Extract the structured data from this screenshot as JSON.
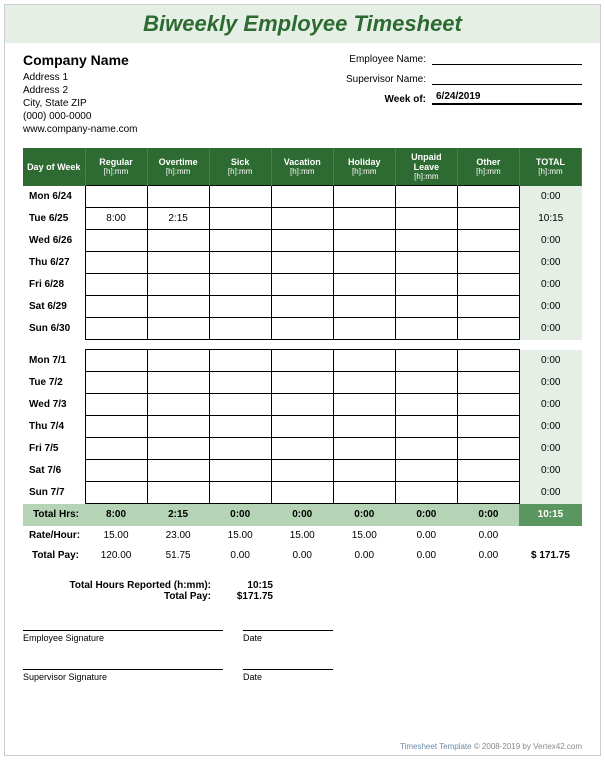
{
  "title": "Biweekly Employee Timesheet",
  "company": {
    "name": "Company Name",
    "addr1": "Address 1",
    "addr2": "Address 2",
    "city": "City, State  ZIP",
    "phone": "(000) 000-0000",
    "url": "www.company-name.com"
  },
  "fields": {
    "employee_label": "Employee Name:",
    "employee_value": "",
    "supervisor_label": "Supervisor Name:",
    "supervisor_value": "",
    "week_of_label": "Week of:",
    "week_of_value": "6/24/2019"
  },
  "columns": [
    {
      "label": "Day of Week",
      "sub": ""
    },
    {
      "label": "Regular",
      "sub": "[h]:mm"
    },
    {
      "label": "Overtime",
      "sub": "[h]:mm"
    },
    {
      "label": "Sick",
      "sub": "[h]:mm"
    },
    {
      "label": "Vacation",
      "sub": "[h]:mm"
    },
    {
      "label": "Holiday",
      "sub": "[h]:mm"
    },
    {
      "label": "Unpaid Leave",
      "sub": "[h]:mm"
    },
    {
      "label": "Other",
      "sub": "[h]:mm"
    },
    {
      "label": "TOTAL",
      "sub": "[h]:mm"
    }
  ],
  "week1": [
    {
      "day": "Mon 6/24",
      "regular": "",
      "overtime": "",
      "sick": "",
      "vacation": "",
      "holiday": "",
      "unpaid": "",
      "other": "",
      "total": "0:00"
    },
    {
      "day": "Tue 6/25",
      "regular": "8:00",
      "overtime": "2:15",
      "sick": "",
      "vacation": "",
      "holiday": "",
      "unpaid": "",
      "other": "",
      "total": "10:15"
    },
    {
      "day": "Wed 6/26",
      "regular": "",
      "overtime": "",
      "sick": "",
      "vacation": "",
      "holiday": "",
      "unpaid": "",
      "other": "",
      "total": "0:00"
    },
    {
      "day": "Thu 6/27",
      "regular": "",
      "overtime": "",
      "sick": "",
      "vacation": "",
      "holiday": "",
      "unpaid": "",
      "other": "",
      "total": "0:00"
    },
    {
      "day": "Fri 6/28",
      "regular": "",
      "overtime": "",
      "sick": "",
      "vacation": "",
      "holiday": "",
      "unpaid": "",
      "other": "",
      "total": "0:00"
    },
    {
      "day": "Sat 6/29",
      "regular": "",
      "overtime": "",
      "sick": "",
      "vacation": "",
      "holiday": "",
      "unpaid": "",
      "other": "",
      "total": "0:00"
    },
    {
      "day": "Sun 6/30",
      "regular": "",
      "overtime": "",
      "sick": "",
      "vacation": "",
      "holiday": "",
      "unpaid": "",
      "other": "",
      "total": "0:00"
    }
  ],
  "week2": [
    {
      "day": "Mon 7/1",
      "regular": "",
      "overtime": "",
      "sick": "",
      "vacation": "",
      "holiday": "",
      "unpaid": "",
      "other": "",
      "total": "0:00"
    },
    {
      "day": "Tue 7/2",
      "regular": "",
      "overtime": "",
      "sick": "",
      "vacation": "",
      "holiday": "",
      "unpaid": "",
      "other": "",
      "total": "0:00"
    },
    {
      "day": "Wed 7/3",
      "regular": "",
      "overtime": "",
      "sick": "",
      "vacation": "",
      "holiday": "",
      "unpaid": "",
      "other": "",
      "total": "0:00"
    },
    {
      "day": "Thu 7/4",
      "regular": "",
      "overtime": "",
      "sick": "",
      "vacation": "",
      "holiday": "",
      "unpaid": "",
      "other": "",
      "total": "0:00"
    },
    {
      "day": "Fri 7/5",
      "regular": "",
      "overtime": "",
      "sick": "",
      "vacation": "",
      "holiday": "",
      "unpaid": "",
      "other": "",
      "total": "0:00"
    },
    {
      "day": "Sat 7/6",
      "regular": "",
      "overtime": "",
      "sick": "",
      "vacation": "",
      "holiday": "",
      "unpaid": "",
      "other": "",
      "total": "0:00"
    },
    {
      "day": "Sun 7/7",
      "regular": "",
      "overtime": "",
      "sick": "",
      "vacation": "",
      "holiday": "",
      "unpaid": "",
      "other": "",
      "total": "0:00"
    }
  ],
  "totals": {
    "label": "Total Hrs:",
    "regular": "8:00",
    "overtime": "2:15",
    "sick": "0:00",
    "vacation": "0:00",
    "holiday": "0:00",
    "unpaid": "0:00",
    "other": "0:00",
    "grand": "10:15"
  },
  "rate": {
    "label": "Rate/Hour:",
    "regular": "15.00",
    "overtime": "23.00",
    "sick": "15.00",
    "vacation": "15.00",
    "holiday": "15.00",
    "unpaid": "0.00",
    "other": "0.00"
  },
  "pay": {
    "label": "Total Pay:",
    "regular": "120.00",
    "overtime": "51.75",
    "sick": "0.00",
    "vacation": "0.00",
    "holiday": "0.00",
    "unpaid": "0.00",
    "other": "0.00",
    "grand": "$   171.75"
  },
  "summary": {
    "hours_label": "Total Hours Reported (h:mm):",
    "hours_value": "10:15",
    "pay_label": "Total Pay:",
    "pay_value": "$171.75"
  },
  "signatures": {
    "employee": "Employee Signature",
    "supervisor": "Supervisor Signature",
    "date": "Date"
  },
  "footer": {
    "link": "Timesheet Template",
    "copy": " © 2008-2019 by Vertex42.com"
  }
}
